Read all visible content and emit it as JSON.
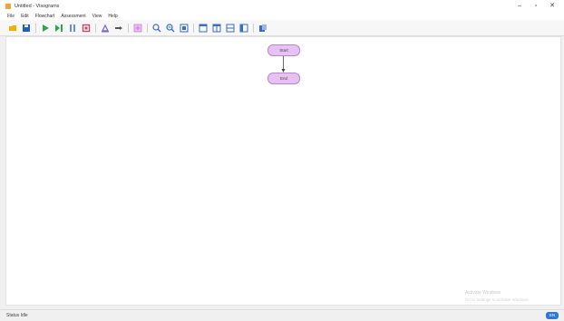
{
  "window": {
    "title": "Untitled - Visograms",
    "controls": {
      "minimize": "–",
      "maximize": "▫",
      "close": "✕"
    }
  },
  "menubar": {
    "items": [
      "File",
      "Edit",
      "Flowchart",
      "Assessment",
      "View",
      "Help"
    ]
  },
  "toolbar": {
    "buttons": [
      {
        "name": "open-icon",
        "color": "#f0b000"
      },
      {
        "name": "save-icon",
        "color": "#1f5fbf"
      },
      {
        "name": "play-icon",
        "color": "#2aa84a"
      },
      {
        "name": "step-icon",
        "color": "#2aa84a"
      },
      {
        "name": "pause-icon",
        "color": "#6a8fcf"
      },
      {
        "name": "stop-icon",
        "color": "#c04a6a"
      },
      {
        "name": "input-icon",
        "color": "#7a5fcf"
      },
      {
        "name": "output-icon",
        "color": "#555555"
      },
      {
        "name": "add-icon",
        "color": "#cf7ad8"
      },
      {
        "name": "zoom-in-icon",
        "color": "#3a6fbf"
      },
      {
        "name": "zoom-out-icon",
        "color": "#3a6fbf"
      },
      {
        "name": "zoom-fit-icon",
        "color": "#3a6fbf"
      },
      {
        "name": "grid-1-icon",
        "color": "#3a6fbf"
      },
      {
        "name": "grid-2-icon",
        "color": "#3a6fbf"
      },
      {
        "name": "grid-3-icon",
        "color": "#3a6fbf"
      },
      {
        "name": "grid-4-icon",
        "color": "#3a6fbf"
      },
      {
        "name": "export-icon",
        "color": "#3a6fbf"
      }
    ]
  },
  "flowchart": {
    "start_label": "Start",
    "end_label": "End"
  },
  "watermark": {
    "line1": "Activate Windows",
    "line2": "Go to Settings to activate Windows."
  },
  "statusbar": {
    "left_text": "Status Idle",
    "badge_text": "EN"
  }
}
